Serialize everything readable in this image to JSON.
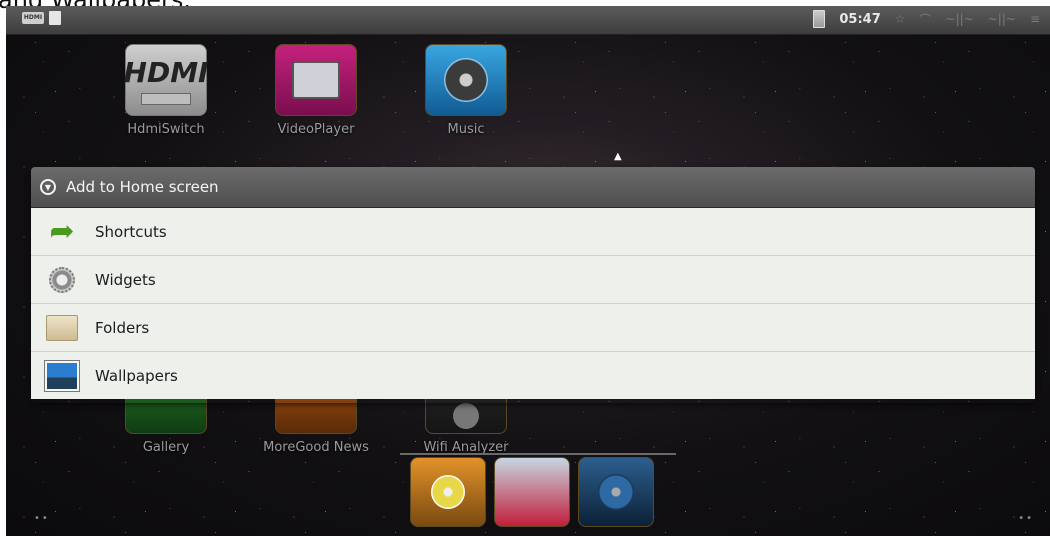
{
  "overlay_text": "and Wallpapers.",
  "statusbar": {
    "left_badge": "HDMI",
    "clock": "05:47",
    "glyphs": [
      "☆",
      "⌒",
      "~||~",
      "~||~",
      "≡"
    ]
  },
  "apps_top": [
    {
      "label": "HdmiSwitch",
      "tile_text": "HDMI"
    },
    {
      "label": "VideoPlayer"
    },
    {
      "label": "Music"
    }
  ],
  "apps_bottom": [
    {
      "label": "Gallery"
    },
    {
      "label": "MoreGood News"
    },
    {
      "label": "Wifi Analyzer"
    }
  ],
  "dialog": {
    "title": "Add to Home screen",
    "items": [
      {
        "label": "Shortcuts",
        "icon": "shortcut-arrow-icon"
      },
      {
        "label": "Widgets",
        "icon": "widget-gear-icon"
      },
      {
        "label": "Folders",
        "icon": "folder-icon"
      },
      {
        "label": "Wallpapers",
        "icon": "wallpaper-icon"
      }
    ]
  },
  "colors": {
    "dialog_title_bg": "#5a5a5a",
    "dialog_list_bg": "#edf0eb",
    "shortcut_green": "#4a9a20"
  }
}
